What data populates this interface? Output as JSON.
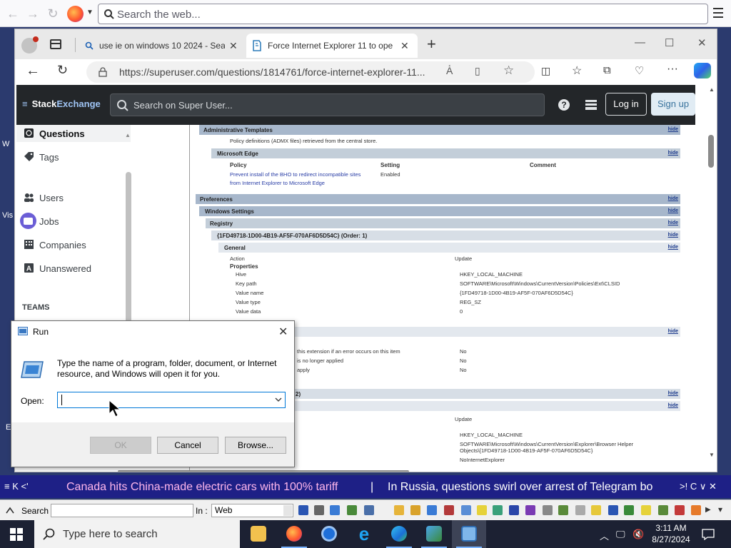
{
  "firefox": {
    "search_placeholder": "Search the web..."
  },
  "desktop_edge_text": [
    "W",
    "Vis",
    "E"
  ],
  "edge": {
    "tabs": [
      {
        "label": "use ie on windows 10 2024 - Sear"
      },
      {
        "label": "Force Internet Explorer 11 to ope"
      }
    ],
    "url": "https://superuser.com/questions/1814761/force-internet-explorer-11..."
  },
  "stackexchange": {
    "logo_a": "Stack",
    "logo_b": "Exchange",
    "search_placeholder": "Search on Super User...",
    "login": "Log in",
    "signup": "Sign up",
    "nav": [
      {
        "label": "Questions",
        "icon": "globe-icon"
      },
      {
        "label": "Tags",
        "icon": "tag-icon"
      },
      {
        "label": "Users",
        "icon": "users-icon"
      },
      {
        "label": "Jobs",
        "icon": "briefcase-icon"
      },
      {
        "label": "Companies",
        "icon": "building-icon"
      },
      {
        "label": "Unanswered",
        "icon": "unanswered-icon"
      }
    ],
    "teams_label": "TEAMS"
  },
  "gpo": {
    "hide": "hide",
    "admin_templates": "Administrative Templates",
    "policy_defs": "Policy definitions (ADMX files) retrieved from the central store.",
    "microsoft_edge": "Microsoft Edge",
    "col_policy": "Policy",
    "col_setting": "Setting",
    "col_comment": "Comment",
    "policy_link_1": "Prevent install of the BHO to redirect incompatible sites",
    "policy_link_2": "from Internet Explorer to Microsoft Edge",
    "policy_setting": "Enabled",
    "preferences": "Preferences",
    "windows_settings": "Windows Settings",
    "registry": "Registry",
    "registry_key": "{1FD49718-1D00-4B19-AF5F-070AF6D5D54C} (Order: 1)",
    "general": "General",
    "action_label": "Action",
    "action_value": "Update",
    "properties": "Properties",
    "props": [
      {
        "k": "Hive",
        "v": "HKEY_LOCAL_MACHINE"
      },
      {
        "k": "Key path",
        "v": "SOFTWARE\\Microsoft\\Windows\\CurrentVersion\\Policies\\Ext\\CLSID"
      },
      {
        "k": "Value name",
        "v": "{1FD49718-1D00-4B19-AF5F-070AF6D5D54C}"
      },
      {
        "k": "Value type",
        "v": "REG_SZ"
      },
      {
        "k": "Value data",
        "v": "0"
      }
    ],
    "common_rows": [
      {
        "k": "this extension if an error occurs on this item",
        "v": "No"
      },
      {
        "k": "is no longer applied",
        "v": "No"
      },
      {
        "k": "apply",
        "v": "No"
      }
    ],
    "order2_fragment": "2)",
    "update2": "Update",
    "hive2": "HKEY_LOCAL_MACHINE",
    "keypath2_a": "SOFTWARE\\Microsoft\\Windows\\CurrentVersion\\Explorer\\Browser Helper",
    "keypath2_b": "Objects\\{1FD49718-1D00-4B19-AF5F-070AF6D5D54C}",
    "value2": "NoInternetExplorer"
  },
  "run_dialog": {
    "title": "Run",
    "description": "Type the name of a program, folder, document, or Internet resource, and Windows will open it for you.",
    "open_label": "Open:",
    "open_value": "",
    "ok": "OK",
    "cancel": "Cancel",
    "browse": "Browse..."
  },
  "ticker": {
    "controls_left": "≡ K <'",
    "item1": "Canada hits China-made electric cars with 100% tariff",
    "divider": "|",
    "item2": "In Russia, questions swirl over arrest of Telegram bo",
    "controls_right": ">! C ∨ ✕"
  },
  "toolbar": {
    "search_label": "Search :",
    "in_label": "In :",
    "in_value": "Web"
  },
  "taskbar": {
    "search_placeholder": "Type here to search",
    "time": "3:11 AM",
    "date": "8/27/2024"
  }
}
